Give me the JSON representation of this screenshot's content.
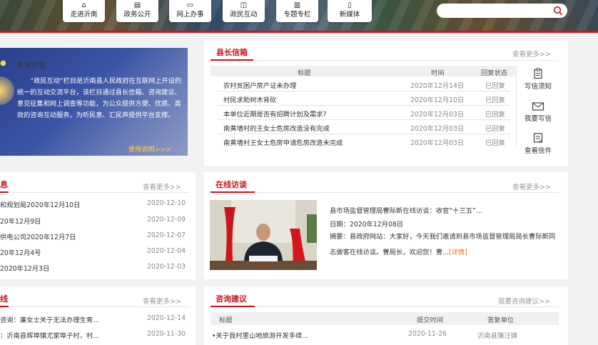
{
  "nav": {
    "items": [
      {
        "label": "走进沂南",
        "icon": "home-icon"
      },
      {
        "label": "政务公开",
        "icon": "document-icon"
      },
      {
        "label": "网上办事",
        "icon": "monitor-icon"
      },
      {
        "label": "政民互动",
        "icon": "chat-icon"
      },
      {
        "label": "专题专栏",
        "icon": "columns-icon"
      },
      {
        "label": "新媒体",
        "icon": "mobile-icon"
      }
    ],
    "search_placeholder": ""
  },
  "intro": {
    "title": "开设宗旨",
    "body": "“政民互动”栏目是沂南县人民政府在互联网上开设的统一的互动交流平台，该栏目通过县长信箱、咨询建议、意见征集和网上调查等功能，为公众提供方便、优质、高效的咨询互动服务，为听民意、汇民声提供平台支撑。",
    "link": "使用说明>>>"
  },
  "mailbox": {
    "title": "县长信箱",
    "more": "查看更多>>",
    "headers": {
      "title": "标题",
      "time": "时间",
      "status": "回复状态"
    },
    "rows": [
      {
        "title": "农村贫困户房产证未办理",
        "time": "2020年12月14日",
        "status": "已回复"
      },
      {
        "title": "村民求助树木背砍",
        "time": "2020年12月10日",
        "status": "已回复"
      },
      {
        "title": "本单位近期是否有招聘计划及需求?",
        "time": "2020年12月03日",
        "status": "已回复"
      },
      {
        "title": "南黄墙村的王女士危房改造没有完成",
        "time": "2020年12月03日",
        "status": "已回复"
      },
      {
        "title": "南黄墙村王女士危房申请危房改造未完成",
        "time": "2020年12月03日",
        "status": "已回复"
      }
    ],
    "actions": [
      {
        "label": "写信须知",
        "icon": "clipboard-icon"
      },
      {
        "label": "我要写信",
        "icon": "envelope-icon"
      },
      {
        "label": "查看信件",
        "icon": "letters-icon"
      }
    ]
  },
  "left_list1": {
    "title": "息",
    "more": "查看更多>>",
    "rows": [
      {
        "title": "和规划局2020年12月10日",
        "date": "2020-12-10"
      },
      {
        "title": "20年12月9日",
        "date": "2020-12-09"
      },
      {
        "title": "供电公司2020年12月7日",
        "date": "2020-12-07"
      },
      {
        "title": "20年12月4号",
        "date": "2020-12-04"
      },
      {
        "title": "2020年12月3日",
        "date": "2020-12-03"
      }
    ]
  },
  "interview": {
    "title": "在线访谈",
    "more": "查看更多>>",
    "headline": "县市场监督管理局曹际新在线访谈：收官“十三五”...",
    "date": "日期：2020年12月08日",
    "summary": "摘要：县政府网站：大家好，今天我们邀请到县市场监督管理局局长曹际新同志做客在线访谈。曹局长，欢迎您！曹...",
    "detail": "[详情]"
  },
  "left_list2": {
    "title": "线",
    "more": "查看更多>>",
    "rows": [
      {
        "title": "咨询：廉女士关于无法办理生育...",
        "date": "2020-12-14"
      },
      {
        "title": "：沂南县辉埠镇尤家埠子村，村...",
        "date": "2020-11-30"
      }
    ]
  },
  "consult": {
    "title": "咨询建议",
    "more": "我要咨询建议>>",
    "headers": {
      "title": "标题",
      "time": "提交时间",
      "unit": "答复单位"
    },
    "rows": [
      {
        "title": "•关于我村里山地旅游开发手续...",
        "time": "2020-11-26",
        "unit": "沂南县蒲汪镇"
      }
    ]
  },
  "colors": {
    "accent": "#c8161d",
    "intro_bg": "#3c55a6",
    "highlight": "#ffd24a"
  }
}
